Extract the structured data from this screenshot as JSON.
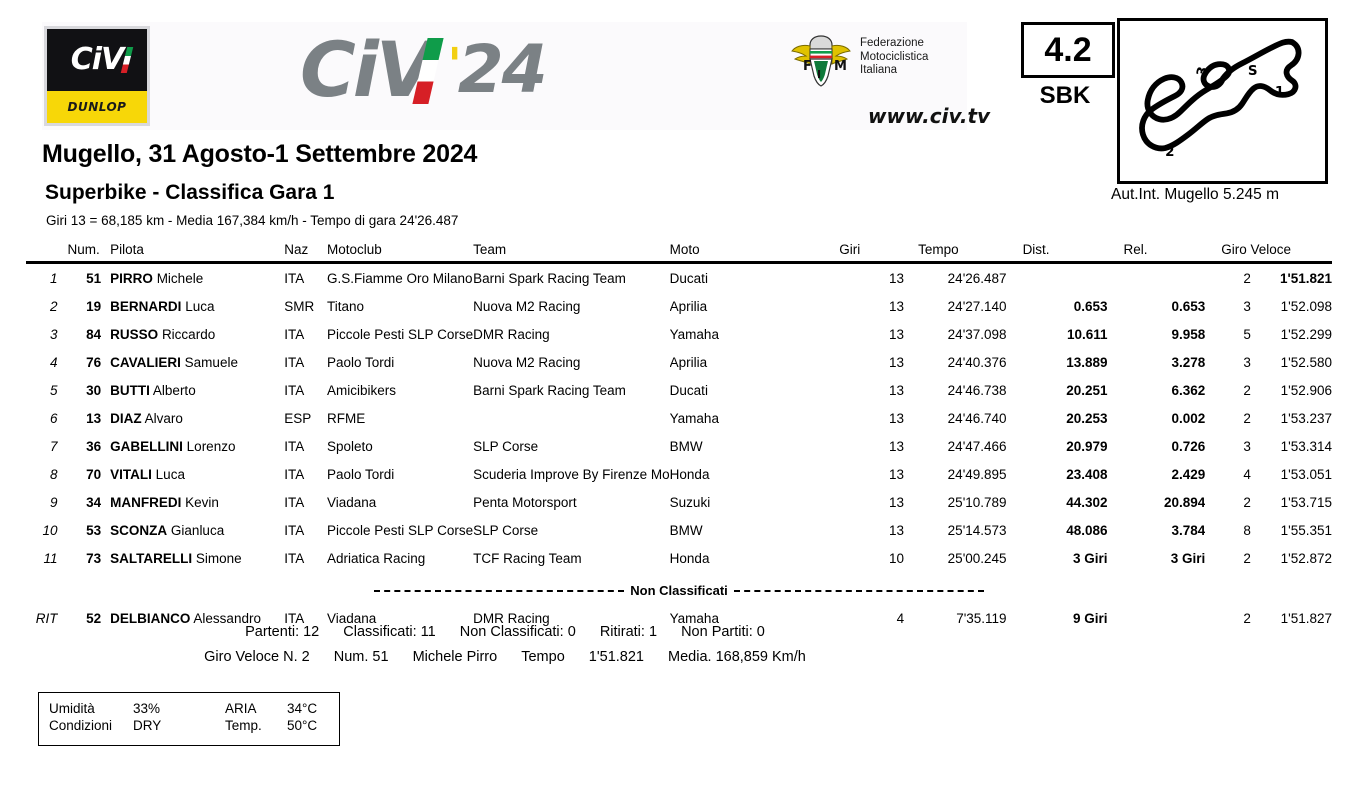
{
  "header": {
    "civ_logo_text": "CiV",
    "dunlop_text": "DUNLOP",
    "wordmark_civ": "CiV",
    "wordmark_apostrophe": "'",
    "wordmark_year": "24",
    "fmi_line1": "Federazione",
    "fmi_line2": "Motociclistica",
    "fmi_line3": "Italiana",
    "website": "www.civ.tv",
    "race_number": "4.2",
    "category": "SBK",
    "circuit_caption": "Aut.Int. Mugello 5.245 m",
    "circuit_markers": [
      "1",
      "2",
      "3",
      "S"
    ]
  },
  "titles": {
    "event": "Mugello, 31 Agosto-1 Settembre 2024",
    "session": "Superbike - Classifica Gara 1",
    "info": "Giri 13 = 68,185 km  -  Media 167,384 km/h  -  Tempo di gara 24'26.487"
  },
  "table": {
    "headers": {
      "pos": "",
      "num": "Num.",
      "pilota": "Pilota",
      "naz": "Naz",
      "motoclub": "Motoclub",
      "team": "Team",
      "moto": "Moto",
      "giri": "Giri",
      "tempo": "Tempo",
      "dist": "Dist.",
      "rel": "Rel.",
      "giro_veloce": "Giro Veloce"
    },
    "classified": [
      {
        "pos": "1",
        "num": "51",
        "surname": "PIRRO",
        "firstname": "Michele",
        "naz": "ITA",
        "motoclub": "G.S.Fiamme Oro Milano",
        "team": "Barni Spark Racing Team",
        "moto": "Ducati",
        "giri": "13",
        "tempo": "24'26.487",
        "dist": "",
        "rel": "",
        "gv_lap": "2",
        "gv_time": "1'51.821",
        "gv_bold": true
      },
      {
        "pos": "2",
        "num": "19",
        "surname": "BERNARDI",
        "firstname": "Luca",
        "naz": "SMR",
        "motoclub": "Titano",
        "team": "Nuova M2 Racing",
        "moto": "Aprilia",
        "giri": "13",
        "tempo": "24'27.140",
        "dist": "0.653",
        "rel": "0.653",
        "gv_lap": "3",
        "gv_time": "1'52.098",
        "gv_bold": false
      },
      {
        "pos": "3",
        "num": "84",
        "surname": "RUSSO",
        "firstname": "Riccardo",
        "naz": "ITA",
        "motoclub": "Piccole Pesti SLP Corse",
        "team": "DMR Racing",
        "moto": "Yamaha",
        "giri": "13",
        "tempo": "24'37.098",
        "dist": "10.611",
        "rel": "9.958",
        "gv_lap": "5",
        "gv_time": "1'52.299",
        "gv_bold": false
      },
      {
        "pos": "4",
        "num": "76",
        "surname": "CAVALIERI",
        "firstname": "Samuele",
        "naz": "ITA",
        "motoclub": "Paolo Tordi",
        "team": "Nuova M2 Racing",
        "moto": "Aprilia",
        "giri": "13",
        "tempo": "24'40.376",
        "dist": "13.889",
        "rel": "3.278",
        "gv_lap": "3",
        "gv_time": "1'52.580",
        "gv_bold": false
      },
      {
        "pos": "5",
        "num": "30",
        "surname": "BUTTI",
        "firstname": "Alberto",
        "naz": "ITA",
        "motoclub": "Amicibikers",
        "team": "Barni Spark Racing Team",
        "moto": "Ducati",
        "giri": "13",
        "tempo": "24'46.738",
        "dist": "20.251",
        "rel": "6.362",
        "gv_lap": "2",
        "gv_time": "1'52.906",
        "gv_bold": false
      },
      {
        "pos": "6",
        "num": "13",
        "surname": "DIAZ",
        "firstname": "Alvaro",
        "naz": "ESP",
        "motoclub": "RFME",
        "team": "",
        "moto": "Yamaha",
        "giri": "13",
        "tempo": "24'46.740",
        "dist": "20.253",
        "rel": "0.002",
        "gv_lap": "2",
        "gv_time": "1'53.237",
        "gv_bold": false
      },
      {
        "pos": "7",
        "num": "36",
        "surname": "GABELLINI",
        "firstname": "Lorenzo",
        "naz": "ITA",
        "motoclub": "Spoleto",
        "team": "SLP Corse",
        "moto": "BMW",
        "giri": "13",
        "tempo": "24'47.466",
        "dist": "20.979",
        "rel": "0.726",
        "gv_lap": "3",
        "gv_time": "1'53.314",
        "gv_bold": false
      },
      {
        "pos": "8",
        "num": "70",
        "surname": "VITALI",
        "firstname": "Luca",
        "naz": "ITA",
        "motoclub": "Paolo Tordi",
        "team": "Scuderia Improve By Firenze Mo",
        "moto": "Honda",
        "giri": "13",
        "tempo": "24'49.895",
        "dist": "23.408",
        "rel": "2.429",
        "gv_lap": "4",
        "gv_time": "1'53.051",
        "gv_bold": false
      },
      {
        "pos": "9",
        "num": "34",
        "surname": "MANFREDI",
        "firstname": "Kevin",
        "naz": "ITA",
        "motoclub": "Viadana",
        "team": "Penta Motorsport",
        "moto": "Suzuki",
        "giri": "13",
        "tempo": "25'10.789",
        "dist": "44.302",
        "rel": "20.894",
        "gv_lap": "2",
        "gv_time": "1'53.715",
        "gv_bold": false
      },
      {
        "pos": "10",
        "num": "53",
        "surname": "SCONZA",
        "firstname": "Gianluca",
        "naz": "ITA",
        "motoclub": "Piccole Pesti SLP Corse",
        "team": "SLP Corse",
        "moto": "BMW",
        "giri": "13",
        "tempo": "25'14.573",
        "dist": "48.086",
        "rel": "3.784",
        "gv_lap": "8",
        "gv_time": "1'55.351",
        "gv_bold": false
      },
      {
        "pos": "11",
        "num": "73",
        "surname": "SALTARELLI",
        "firstname": "Simone",
        "naz": "ITA",
        "motoclub": "Adriatica Racing",
        "team": "TCF Racing Team",
        "moto": "Honda",
        "giri": "10",
        "tempo": "25'00.245",
        "dist": "3  Giri",
        "rel": "3  Giri",
        "gv_lap": "2",
        "gv_time": "1'52.872",
        "gv_bold": false
      }
    ],
    "divider_label": "Non Classificati",
    "unclassified": [
      {
        "pos": "RIT",
        "num": "52",
        "surname": "DELBIANCO",
        "firstname": "Alessandro",
        "naz": "ITA",
        "motoclub": "Viadana",
        "team": "DMR Racing",
        "moto": "Yamaha",
        "giri": "4",
        "tempo": "7'35.119",
        "dist": "9  Giri",
        "rel": "",
        "gv_lap": "2",
        "gv_time": "1'51.827",
        "gv_bold": false
      }
    ]
  },
  "summary": {
    "partenti": "Partenti: 12",
    "classificati": "Classificati: 11",
    "non_classificati": "Non Classificati: 0",
    "ritirati": "Ritirati: 1",
    "non_partiti": "Non Partiti: 0",
    "gv_label": "Giro Veloce N. 2",
    "gv_num": "Num. 51",
    "gv_rider": "Michele Pirro",
    "gv_tempo_label": "Tempo",
    "gv_tempo": "1'51.821",
    "gv_media": "Media. 168,859 Km/h"
  },
  "weather": {
    "humidity_label": "Umidità",
    "humidity_value": "33%",
    "air_label": "ARIA",
    "air_value": "34°C",
    "conditions_label": "Condizioni",
    "conditions_value": "DRY",
    "temp_label": "Temp.",
    "temp_value": "50°C"
  }
}
